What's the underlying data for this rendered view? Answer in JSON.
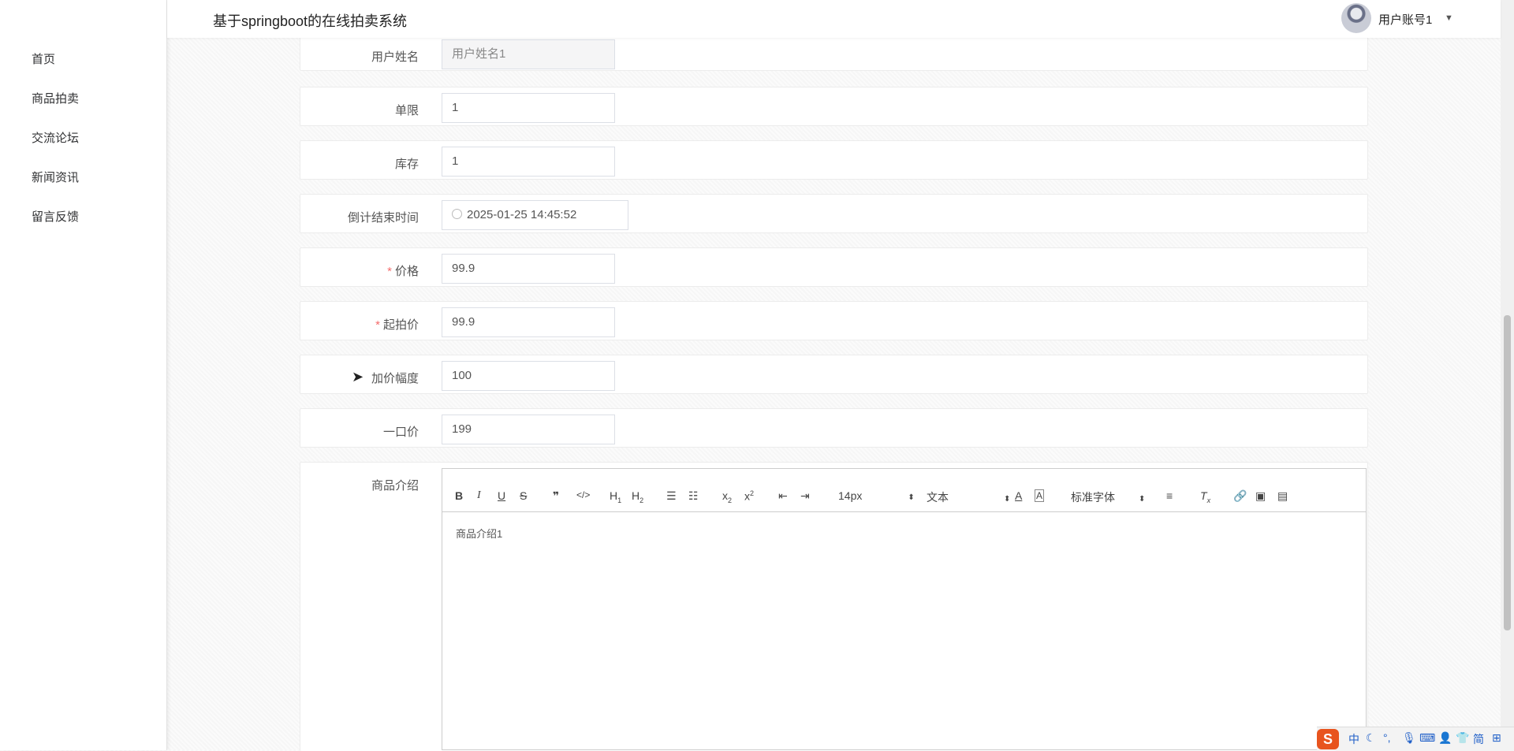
{
  "header": {
    "title": "基于springboot的在线拍卖系统",
    "user": "用户账号1"
  },
  "sidebar": {
    "items": [
      {
        "label": "首页"
      },
      {
        "label": "商品拍卖"
      },
      {
        "label": "交流论坛"
      },
      {
        "label": "新闻资讯"
      },
      {
        "label": "留言反馈"
      }
    ]
  },
  "form": {
    "username": {
      "label": "用户姓名",
      "value": "用户姓名1"
    },
    "limit": {
      "label": "单限",
      "value": "1"
    },
    "stock": {
      "label": "库存",
      "value": "1"
    },
    "countdown": {
      "label": "倒计结束时间",
      "value": "2025-01-25 14:45:52"
    },
    "price": {
      "label": "价格",
      "value": "99.9",
      "required_mark": "*"
    },
    "start_price": {
      "label": "起拍价",
      "value": "99.9",
      "required_mark": "*"
    },
    "increment": {
      "label": "加价幅度",
      "value": "100"
    },
    "buyout": {
      "label": "一口价",
      "value": "199"
    },
    "intro": {
      "label": "商品介绍",
      "content": "商品介绍1"
    }
  },
  "toolbar": {
    "font_size": "14px",
    "format": "文本",
    "font_family": "标准字体"
  },
  "ime": {
    "items": [
      "中",
      "简"
    ]
  }
}
